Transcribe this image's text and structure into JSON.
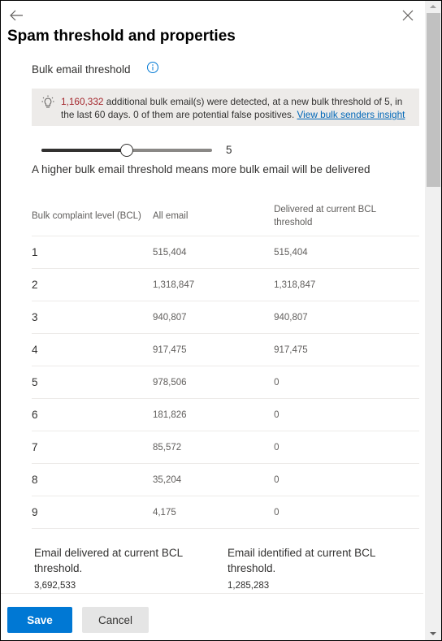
{
  "panel": {
    "title": "Spam threshold and properties",
    "back_icon": "arrow-left-icon",
    "close_icon": "close-icon"
  },
  "threshold": {
    "label": "Bulk email threshold",
    "info_icon": "info-icon",
    "banner": {
      "icon": "lightbulb-icon",
      "count": "1,160,332",
      "text": "additional bulk email(s) were detected, at a new bulk threshold of 5, in the last 60 days. 0 of them are potential false positives.",
      "link": "View bulk senders insight"
    },
    "slider": {
      "value": "5",
      "min": 1,
      "max": 9,
      "fraction": 0.5
    },
    "hint": "A higher bulk email threshold means more bulk email will be delivered"
  },
  "table": {
    "headers": [
      "Bulk complaint level (BCL)",
      "All email",
      "Delivered at current BCL threshold"
    ],
    "rows": [
      {
        "level": "1",
        "all": "515,404",
        "delivered": "515,404"
      },
      {
        "level": "2",
        "all": "1,318,847",
        "delivered": "1,318,847"
      },
      {
        "level": "3",
        "all": "940,807",
        "delivered": "940,807"
      },
      {
        "level": "4",
        "all": "917,475",
        "delivered": "917,475"
      },
      {
        "level": "5",
        "all": "978,506",
        "delivered": "0"
      },
      {
        "level": "6",
        "all": "181,826",
        "delivered": "0"
      },
      {
        "level": "7",
        "all": "85,572",
        "delivered": "0"
      },
      {
        "level": "8",
        "all": "35,204",
        "delivered": "0"
      },
      {
        "level": "9",
        "all": "4,175",
        "delivered": "0"
      }
    ]
  },
  "summary": {
    "delivered_label": "Email delivered at current BCL threshold.",
    "delivered_value": "3,692,533",
    "identified_label": "Email identified at current BCL threshold.",
    "identified_value": "1,285,283"
  },
  "footer": {
    "save_label": "Save",
    "cancel_label": "Cancel"
  },
  "colors": {
    "primary": "#0078d4",
    "link": "#0067b8",
    "banner_bg": "#edebe9"
  }
}
